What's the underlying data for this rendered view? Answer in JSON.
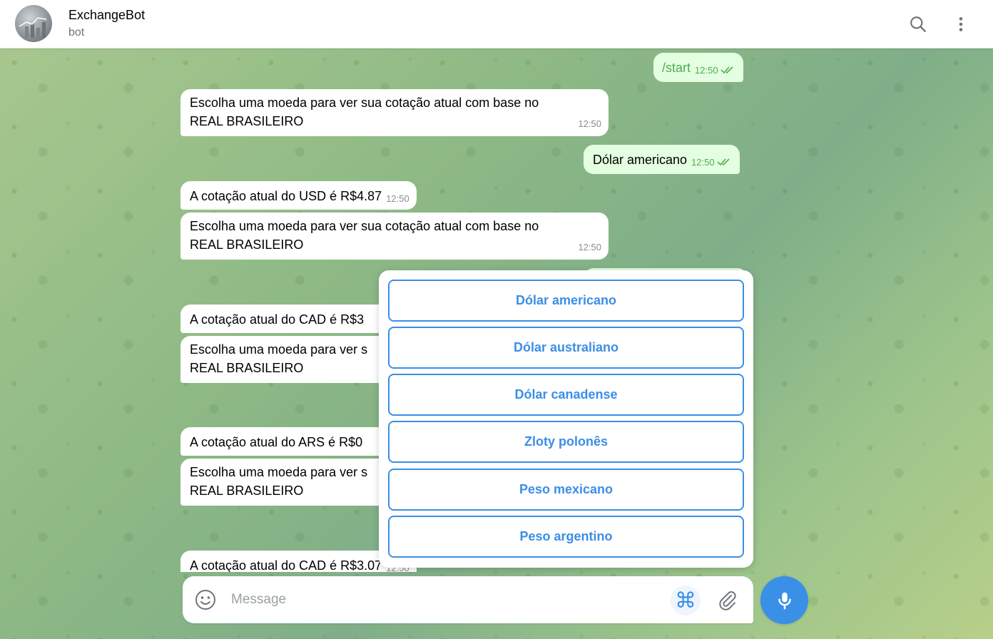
{
  "header": {
    "title": "ExchangeBot",
    "subtitle": "bot"
  },
  "messages": [
    {
      "dir": "out",
      "text": "/start",
      "time": "12:50"
    },
    {
      "dir": "in",
      "line1": "Escolha uma moeda para ver sua cotação atual com base no",
      "line2": "REAL BRASILEIRO",
      "time": "12:50"
    },
    {
      "dir": "out",
      "text": "Dólar americano",
      "time": "12:50"
    },
    {
      "dir": "in",
      "text": "A cotação atual do USD é R$4.87",
      "time": "12:50"
    },
    {
      "dir": "in",
      "line1": "Escolha uma moeda para ver sua cotação atual com base no",
      "line2": "REAL BRASILEIRO",
      "time": "12:50"
    },
    {
      "dir": "in",
      "text": "A cotação atual do CAD é R$3"
    },
    {
      "dir": "in",
      "line1": "Escolha uma moeda para ver s",
      "line2": "REAL BRASILEIRO"
    },
    {
      "dir": "in",
      "text": "A cotação atual do ARS é R$0"
    },
    {
      "dir": "in",
      "line1": "Escolha uma moeda para ver s",
      "line2": "REAL BRASILEIRO"
    },
    {
      "dir": "in",
      "text": "A cotação atual do CAD é R$3.07",
      "time": "12:50"
    }
  ],
  "keyboard": {
    "buttons": [
      "Dólar americano",
      "Dólar australiano",
      "Dólar canadense",
      "Zloty polonês",
      "Peso mexicano",
      "Peso argentino"
    ]
  },
  "composer": {
    "placeholder": "Message",
    "command_glyph": "⌘"
  },
  "icons": {
    "search": "search-icon",
    "more": "more-vertical-icon",
    "emoji": "smile-icon",
    "attach": "paperclip-icon",
    "mic": "microphone-icon",
    "read": "double-check-icon"
  },
  "colors": {
    "accent": "#3a8ee6",
    "outgoing_bubble": "#e3fee0",
    "read_check": "#4fae4e"
  }
}
